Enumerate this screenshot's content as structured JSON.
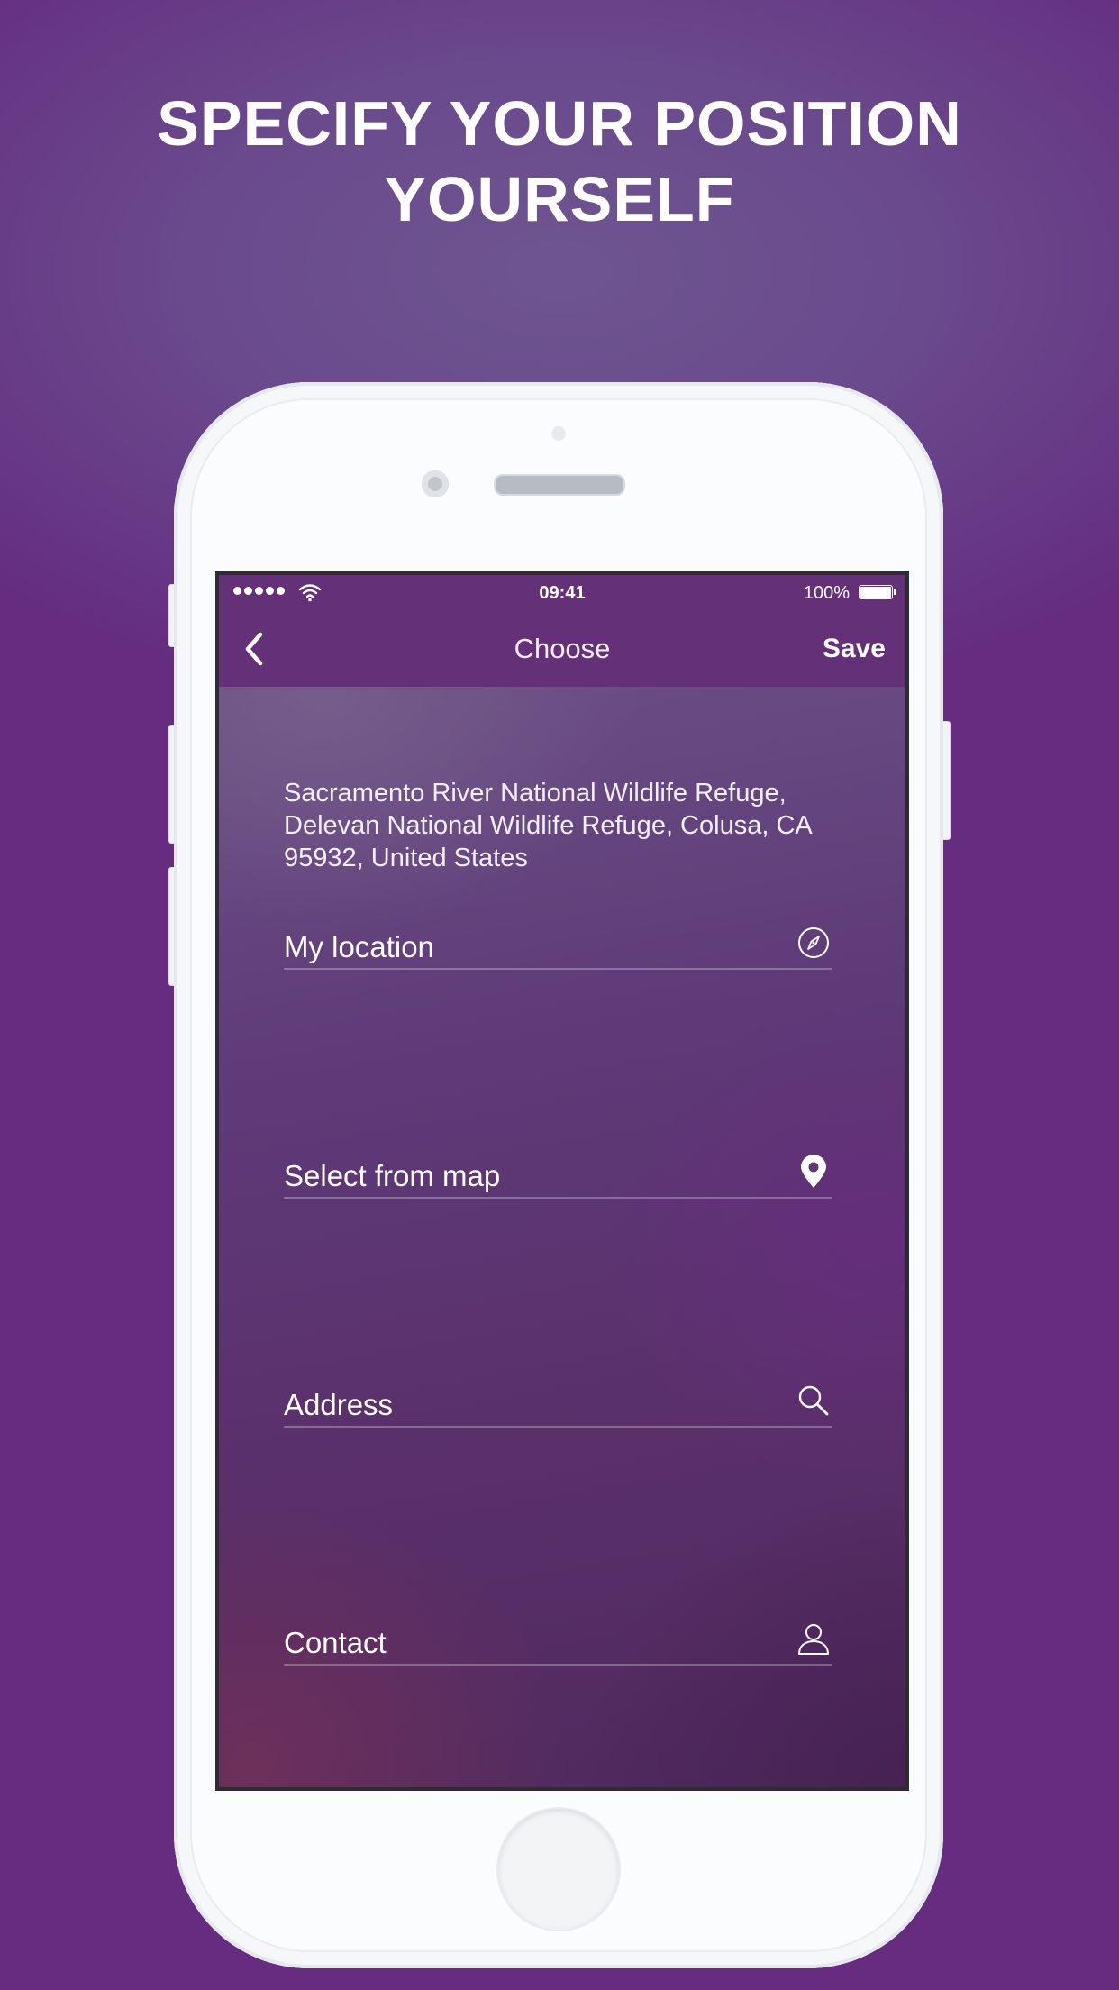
{
  "headline": {
    "line1": "SPECIFY YOUR POSITION",
    "line2": "YOURSELF"
  },
  "statusbar": {
    "time": "09:41",
    "battery": "100%"
  },
  "navbar": {
    "title": "Choose",
    "save_label": "Save"
  },
  "current_address": "Sacramento River National Wildlife Refuge, Delevan National Wildlife Refuge, Colusa, CA 95932, United States",
  "options": [
    {
      "label": "My location",
      "icon": "compass-icon"
    },
    {
      "label": "Select from map",
      "icon": "map-pin-icon"
    },
    {
      "label": "Address",
      "icon": "search-icon"
    },
    {
      "label": "Contact",
      "icon": "person-icon"
    }
  ],
  "colors": {
    "background": "#652c80",
    "bar": "#643178",
    "text": "#ffffff"
  }
}
